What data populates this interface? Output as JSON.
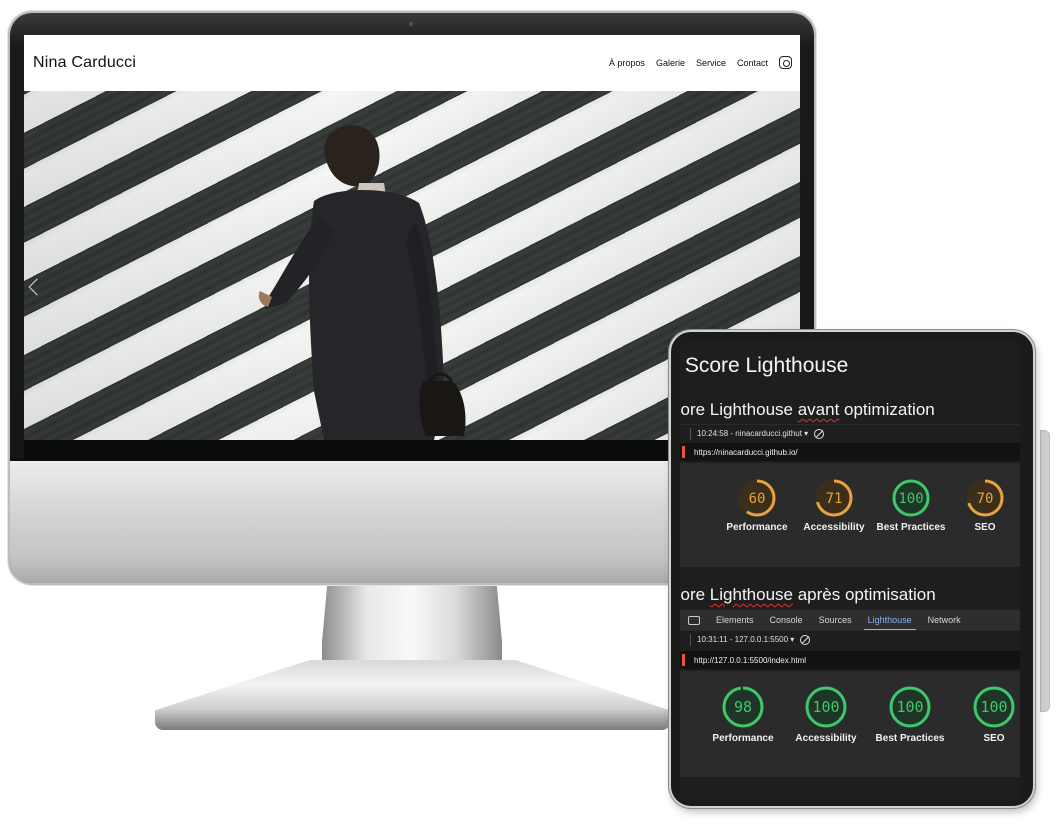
{
  "website": {
    "title": "Nina Carducci",
    "nav": [
      "À propos",
      "Galerie",
      "Service",
      "Contact"
    ],
    "instagram_icon": "instagram-icon"
  },
  "lighthouse": {
    "heading": "- Score Lighthouse",
    "before": {
      "heading_prefix": "core Lighthouse ",
      "heading_squiggle": "avant",
      "heading_suffix": " optimization",
      "run": "10:24:58 - ninacarducci.githut ▾",
      "url": "https://ninacarducci.github.io/",
      "scores": [
        {
          "label": "Performance",
          "value": 60,
          "color": "#e8a33d"
        },
        {
          "label": "Accessibility",
          "value": 71,
          "color": "#e8a33d"
        },
        {
          "label": "Best Practices",
          "value": 100,
          "color": "#3ec86b"
        },
        {
          "label": "SEO",
          "value": 70,
          "color": "#e8a33d"
        }
      ]
    },
    "after": {
      "heading_prefix": "core ",
      "heading_squiggle": "Lighthouse",
      "heading_suffix": " après optimisation",
      "tabs": [
        "Elements",
        "Console",
        "Sources",
        "Lighthouse",
        "Network"
      ],
      "active_tab": "Lighthouse",
      "run": "10:31:11 - 127.0.0.1:5500 ▾",
      "url": "http://127.0.0.1:5500/index.html",
      "scores": [
        {
          "label": "Performance",
          "value": 98,
          "color": "#3ec86b"
        },
        {
          "label": "Accessibility",
          "value": 100,
          "color": "#3ec86b"
        },
        {
          "label": "Best Practices",
          "value": 100,
          "color": "#3ec86b"
        },
        {
          "label": "SEO",
          "value": 100,
          "color": "#3ec86b"
        }
      ]
    }
  }
}
